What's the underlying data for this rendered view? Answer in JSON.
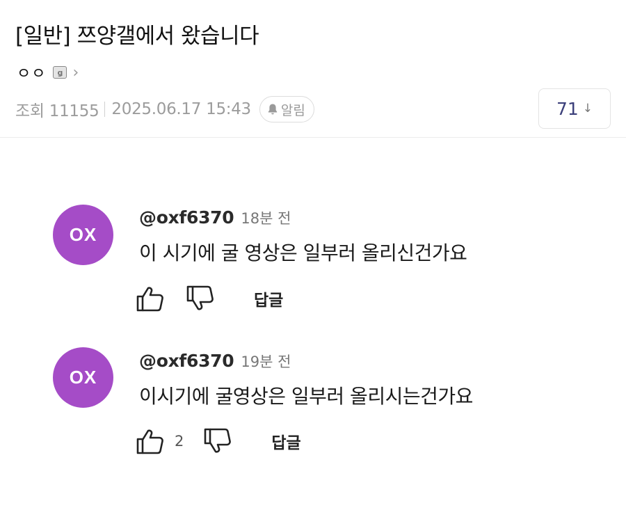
{
  "post": {
    "title": "[일반] 쯔양갤에서 왔습니다",
    "author": "ㅇㅇ",
    "views_label": "조회 11155",
    "datetime": "2025.06.17 15:43",
    "alarm_label": "알림",
    "comment_count": "71",
    "icons": {
      "author_badge": "fixed-user-icon",
      "author_link": "chevron-right-icon",
      "alarm": "bell-icon",
      "sort": "down-arrow-icon"
    }
  },
  "comments": [
    {
      "avatar_text": "OX",
      "avatar_color": "#a54cc7",
      "handle": "@oxf6370",
      "time": "18분 전",
      "text": "이 시기에 굴 영상은 일부러 올리신건가요",
      "likes": "",
      "reply_label": "답글"
    },
    {
      "avatar_text": "OX",
      "avatar_color": "#a54cc7",
      "handle": "@oxf6370",
      "time": "19분 전",
      "text": "이시기에 굴영상은 일부러 올리시는건가요",
      "likes": "2",
      "reply_label": "답글"
    }
  ]
}
